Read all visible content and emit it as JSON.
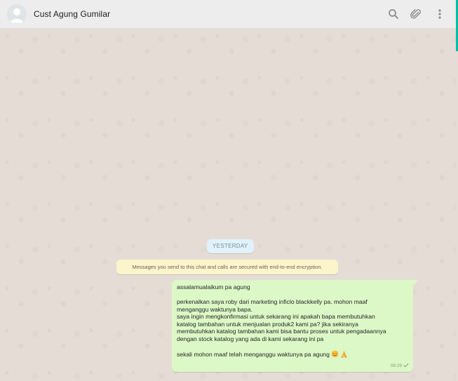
{
  "header": {
    "contact_name": "Cust Agung Gumilar",
    "icons": [
      "search-icon",
      "paperclip-icon",
      "menu-icon"
    ]
  },
  "chat": {
    "date_label": "YESTERDAY",
    "encryption_notice": "Messages you send to this chat and calls are secured with end-to-end encryption.",
    "message": {
      "lines": [
        "assalamualaikum pa agung",
        "",
        "perkenalkan saya roby dari marketing inficlo blackkelly pa. mohon maaf",
        "menganggu waktunya bapa.",
        "saya ingin mengkonfirmasi untuk sekarang ini apakah bapa membutuhkan",
        "katalog tambahan untuk menjualan produk2 kami pa? jika sekiranya",
        "membutuhkan katalog tambahan kami bisa bantu proses untuk pengadaannya",
        "dengan stock katalog yang ada di kami sekarang ini pa",
        "",
        "sekali mohon maaf telah menganggu waktunya pa agung"
      ],
      "emojis": [
        "smiling-face-icon",
        "folded-hands-icon"
      ],
      "time": "09:29",
      "status_icon": "single-check-icon"
    }
  },
  "colors": {
    "accent": "#00bfa5",
    "header_bg": "#ededed",
    "wallpaper": "#e5ddd5",
    "outgoing_bubble": "#dcf8c6",
    "date_chip": "#e1f2fb",
    "notice_bg": "#fcf4cb"
  }
}
